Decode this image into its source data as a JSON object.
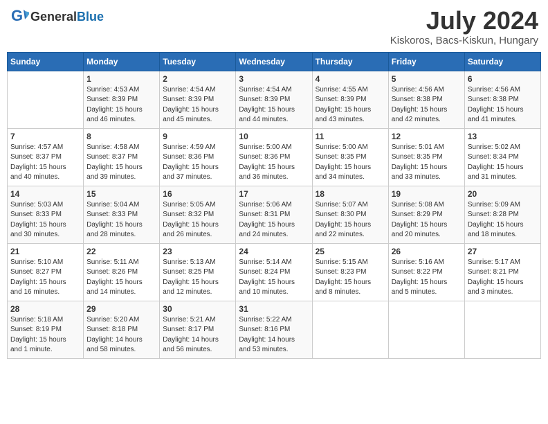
{
  "header": {
    "logo_general": "General",
    "logo_blue": "Blue",
    "month_year": "July 2024",
    "location": "Kiskoros, Bacs-Kiskun, Hungary"
  },
  "columns": [
    "Sunday",
    "Monday",
    "Tuesday",
    "Wednesday",
    "Thursday",
    "Friday",
    "Saturday"
  ],
  "weeks": [
    [
      {
        "day": "",
        "info": ""
      },
      {
        "day": "1",
        "info": "Sunrise: 4:53 AM\nSunset: 8:39 PM\nDaylight: 15 hours\nand 46 minutes."
      },
      {
        "day": "2",
        "info": "Sunrise: 4:54 AM\nSunset: 8:39 PM\nDaylight: 15 hours\nand 45 minutes."
      },
      {
        "day": "3",
        "info": "Sunrise: 4:54 AM\nSunset: 8:39 PM\nDaylight: 15 hours\nand 44 minutes."
      },
      {
        "day": "4",
        "info": "Sunrise: 4:55 AM\nSunset: 8:39 PM\nDaylight: 15 hours\nand 43 minutes."
      },
      {
        "day": "5",
        "info": "Sunrise: 4:56 AM\nSunset: 8:38 PM\nDaylight: 15 hours\nand 42 minutes."
      },
      {
        "day": "6",
        "info": "Sunrise: 4:56 AM\nSunset: 8:38 PM\nDaylight: 15 hours\nand 41 minutes."
      }
    ],
    [
      {
        "day": "7",
        "info": "Sunrise: 4:57 AM\nSunset: 8:37 PM\nDaylight: 15 hours\nand 40 minutes."
      },
      {
        "day": "8",
        "info": "Sunrise: 4:58 AM\nSunset: 8:37 PM\nDaylight: 15 hours\nand 39 minutes."
      },
      {
        "day": "9",
        "info": "Sunrise: 4:59 AM\nSunset: 8:36 PM\nDaylight: 15 hours\nand 37 minutes."
      },
      {
        "day": "10",
        "info": "Sunrise: 5:00 AM\nSunset: 8:36 PM\nDaylight: 15 hours\nand 36 minutes."
      },
      {
        "day": "11",
        "info": "Sunrise: 5:00 AM\nSunset: 8:35 PM\nDaylight: 15 hours\nand 34 minutes."
      },
      {
        "day": "12",
        "info": "Sunrise: 5:01 AM\nSunset: 8:35 PM\nDaylight: 15 hours\nand 33 minutes."
      },
      {
        "day": "13",
        "info": "Sunrise: 5:02 AM\nSunset: 8:34 PM\nDaylight: 15 hours\nand 31 minutes."
      }
    ],
    [
      {
        "day": "14",
        "info": "Sunrise: 5:03 AM\nSunset: 8:33 PM\nDaylight: 15 hours\nand 30 minutes."
      },
      {
        "day": "15",
        "info": "Sunrise: 5:04 AM\nSunset: 8:33 PM\nDaylight: 15 hours\nand 28 minutes."
      },
      {
        "day": "16",
        "info": "Sunrise: 5:05 AM\nSunset: 8:32 PM\nDaylight: 15 hours\nand 26 minutes."
      },
      {
        "day": "17",
        "info": "Sunrise: 5:06 AM\nSunset: 8:31 PM\nDaylight: 15 hours\nand 24 minutes."
      },
      {
        "day": "18",
        "info": "Sunrise: 5:07 AM\nSunset: 8:30 PM\nDaylight: 15 hours\nand 22 minutes."
      },
      {
        "day": "19",
        "info": "Sunrise: 5:08 AM\nSunset: 8:29 PM\nDaylight: 15 hours\nand 20 minutes."
      },
      {
        "day": "20",
        "info": "Sunrise: 5:09 AM\nSunset: 8:28 PM\nDaylight: 15 hours\nand 18 minutes."
      }
    ],
    [
      {
        "day": "21",
        "info": "Sunrise: 5:10 AM\nSunset: 8:27 PM\nDaylight: 15 hours\nand 16 minutes."
      },
      {
        "day": "22",
        "info": "Sunrise: 5:11 AM\nSunset: 8:26 PM\nDaylight: 15 hours\nand 14 minutes."
      },
      {
        "day": "23",
        "info": "Sunrise: 5:13 AM\nSunset: 8:25 PM\nDaylight: 15 hours\nand 12 minutes."
      },
      {
        "day": "24",
        "info": "Sunrise: 5:14 AM\nSunset: 8:24 PM\nDaylight: 15 hours\nand 10 minutes."
      },
      {
        "day": "25",
        "info": "Sunrise: 5:15 AM\nSunset: 8:23 PM\nDaylight: 15 hours\nand 8 minutes."
      },
      {
        "day": "26",
        "info": "Sunrise: 5:16 AM\nSunset: 8:22 PM\nDaylight: 15 hours\nand 5 minutes."
      },
      {
        "day": "27",
        "info": "Sunrise: 5:17 AM\nSunset: 8:21 PM\nDaylight: 15 hours\nand 3 minutes."
      }
    ],
    [
      {
        "day": "28",
        "info": "Sunrise: 5:18 AM\nSunset: 8:19 PM\nDaylight: 15 hours\nand 1 minute."
      },
      {
        "day": "29",
        "info": "Sunrise: 5:20 AM\nSunset: 8:18 PM\nDaylight: 14 hours\nand 58 minutes."
      },
      {
        "day": "30",
        "info": "Sunrise: 5:21 AM\nSunset: 8:17 PM\nDaylight: 14 hours\nand 56 minutes."
      },
      {
        "day": "31",
        "info": "Sunrise: 5:22 AM\nSunset: 8:16 PM\nDaylight: 14 hours\nand 53 minutes."
      },
      {
        "day": "",
        "info": ""
      },
      {
        "day": "",
        "info": ""
      },
      {
        "day": "",
        "info": ""
      }
    ]
  ]
}
